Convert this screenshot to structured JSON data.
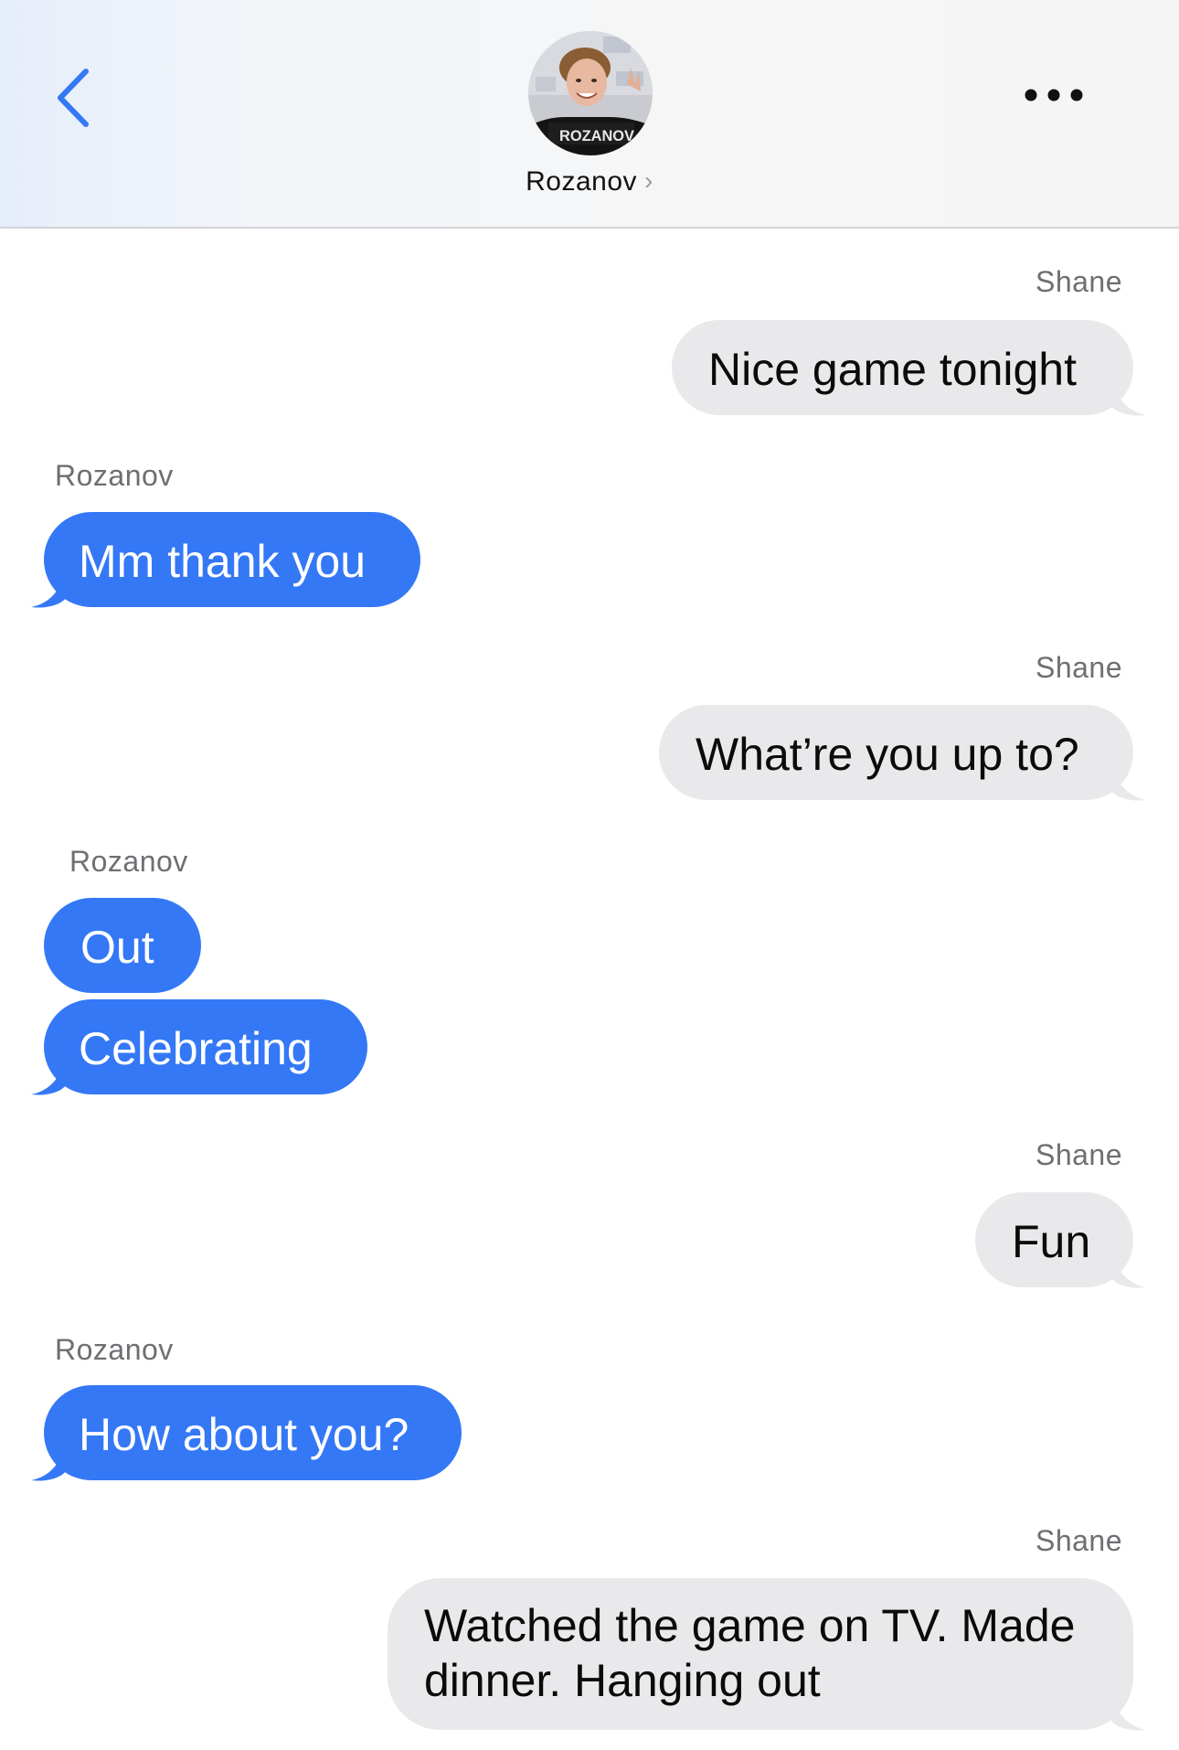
{
  "header": {
    "contact_name": "Rozanov",
    "chevron": "›",
    "avatar_jersey_text": "ROZANOV",
    "back_icon": "chevron-left-icon",
    "more_icon": "ellipsis-icon"
  },
  "colors": {
    "incoming_bubble": "#3478f6",
    "outgoing_bubble": "#e9e9eb",
    "back_icon": "#3478f6"
  },
  "messages": [
    {
      "sender": "Shane",
      "text": "Nice game tonight",
      "direction": "outgoing"
    },
    {
      "sender": "Rozanov",
      "text": "Mm thank you",
      "direction": "incoming"
    },
    {
      "sender": "Shane",
      "text": "What’re you up to?",
      "direction": "outgoing"
    },
    {
      "sender": "Rozanov",
      "text": "Out",
      "direction": "incoming"
    },
    {
      "sender": "",
      "text": "Celebrating",
      "direction": "incoming"
    },
    {
      "sender": "Shane",
      "text": "Fun",
      "direction": "outgoing"
    },
    {
      "sender": "Rozanov",
      "text": "How about you?",
      "direction": "incoming"
    },
    {
      "sender": "Shane",
      "text": "Watched the game on TV. Made",
      "text2": "dinner. Hanging out",
      "direction": "outgoing"
    }
  ]
}
